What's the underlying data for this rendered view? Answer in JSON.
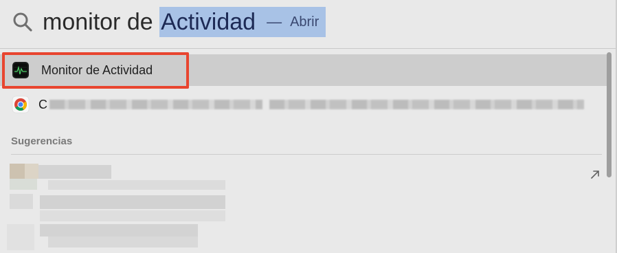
{
  "search": {
    "query_typed": "monitor de ",
    "query_completion": "Actividad",
    "action_dash": "—",
    "action_label": "Abrir"
  },
  "results": [
    {
      "label": "Monitor de Actividad",
      "icon": "activity-monitor-app-icon",
      "selected": true
    },
    {
      "label": "C",
      "icon": "chrome-app-icon",
      "selected": false,
      "redacted": true
    }
  ],
  "sections": {
    "suggestions_title": "Sugerencias"
  },
  "colors": {
    "highlight_outline": "#e8452f",
    "selection_text": "#a8c2e6",
    "selected_row": "#cdcdcd",
    "panel_background": "#e9e9e9"
  }
}
